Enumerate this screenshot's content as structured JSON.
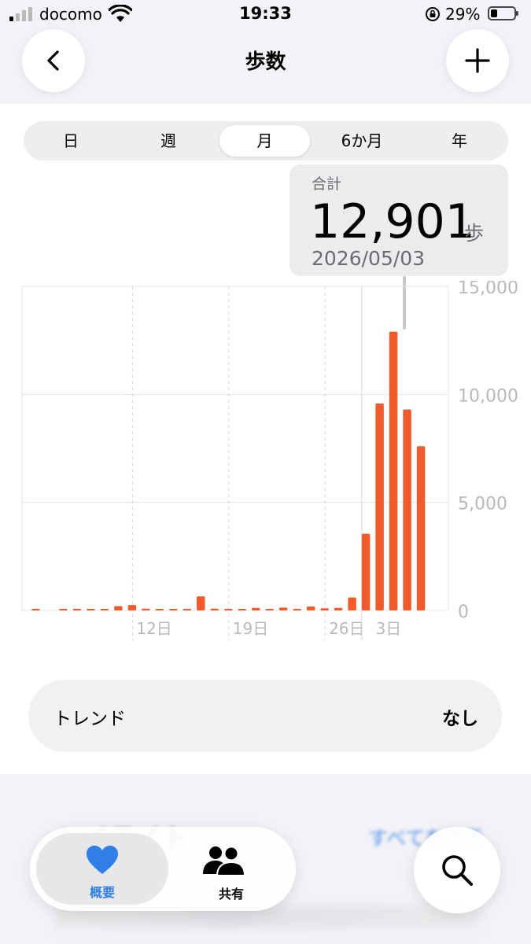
{
  "status_bar": {
    "carrier": "docomo",
    "time": "19:33",
    "battery": "29%",
    "battery_level": 0.29
  },
  "header": {
    "title": "歩数"
  },
  "segments": [
    "日",
    "週",
    "月",
    "6か月",
    "年"
  ],
  "selected_segment": "月",
  "tooltip": {
    "label": "合計",
    "value": "12,901",
    "unit": "歩",
    "date": "2026/05/03"
  },
  "colors": {
    "bar": "#f05b2b",
    "accent": "#2f7fe6"
  },
  "chart_data": {
    "type": "bar",
    "series": [
      {
        "values": [
          60,
          0,
          40,
          50,
          60,
          50,
          200,
          250,
          80,
          50,
          60,
          60,
          650,
          80,
          60,
          50,
          120,
          60,
          130,
          60,
          180,
          100,
          120,
          600,
          3550,
          9580,
          12901,
          9300,
          7600
        ]
      }
    ],
    "ylim": [
      0,
      15000
    ],
    "yticks": [
      "15,000",
      "10,000",
      "5,000",
      "0"
    ],
    "xticks": [
      "12日",
      "19日",
      "26日",
      "3日"
    ],
    "xtick_indices": [
      8,
      15,
      22,
      29
    ],
    "highlight_index": 26,
    "grid": true
  },
  "trend": {
    "label": "トレンド",
    "value": "なし"
  },
  "highlights": {
    "title": "ハイライト",
    "see_all": "すべてを表示"
  },
  "tabs": [
    {
      "label": "概要",
      "icon": "heart-icon",
      "selected": true
    },
    {
      "label": "共有",
      "icon": "people-icon",
      "selected": false
    }
  ]
}
